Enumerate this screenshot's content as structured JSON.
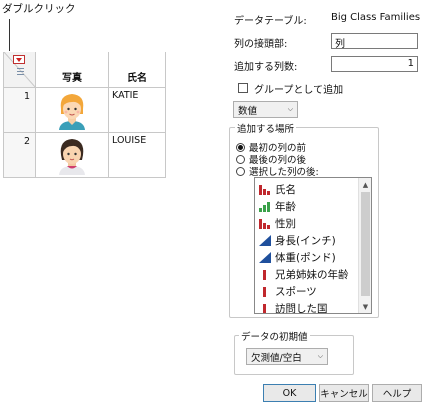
{
  "annotation": {
    "callout": "ダブルクリック"
  },
  "table": {
    "columns": [
      "写真",
      "氏名"
    ],
    "rows": [
      {
        "row": "1",
        "name": "KATIE"
      },
      {
        "row": "2",
        "name": "LOUISE"
      }
    ]
  },
  "dialog": {
    "data_table_label": "データテーブル:",
    "data_table_value": "Big Class Families",
    "prefix_label": "列の接頭部:",
    "prefix_value": "列",
    "count_label": "追加する列数:",
    "count_value": "1",
    "group_checkbox_label": "グループとして追加",
    "type_select_value": "数値",
    "location_group_label": "追加する場所",
    "location_options": [
      "最初の列の前",
      "最後の列の後",
      "選択した列の後:"
    ],
    "column_list": [
      {
        "label": "氏名",
        "icon": "nominal-red-bars-icon"
      },
      {
        "label": "年齢",
        "icon": "ordinal-green-bars-icon"
      },
      {
        "label": "性別",
        "icon": "nominal-red-bars-icon"
      },
      {
        "label": "身長(インチ)",
        "icon": "continuous-blue-triangle-icon"
      },
      {
        "label": "体重(ポンド)",
        "icon": "continuous-blue-triangle-icon"
      },
      {
        "label": "兄弟姉妹の年齢",
        "icon": "unstructured-red-bar-icon"
      },
      {
        "label": "スポーツ",
        "icon": "unstructured-red-bar-icon"
      },
      {
        "label": "訪問した国",
        "icon": "unstructured-red-bar-icon"
      }
    ],
    "initial_value_group_label": "データの初期値",
    "initial_value_select": "欠測値/空白",
    "buttons": {
      "ok": "OK",
      "cancel": "キャンセル",
      "help": "ヘルプ"
    }
  },
  "colors": {
    "nominal": "#c0282d",
    "ordinal": "#3aa14a",
    "continuous": "#1f4f9c",
    "accent": "#3c7fb1"
  }
}
